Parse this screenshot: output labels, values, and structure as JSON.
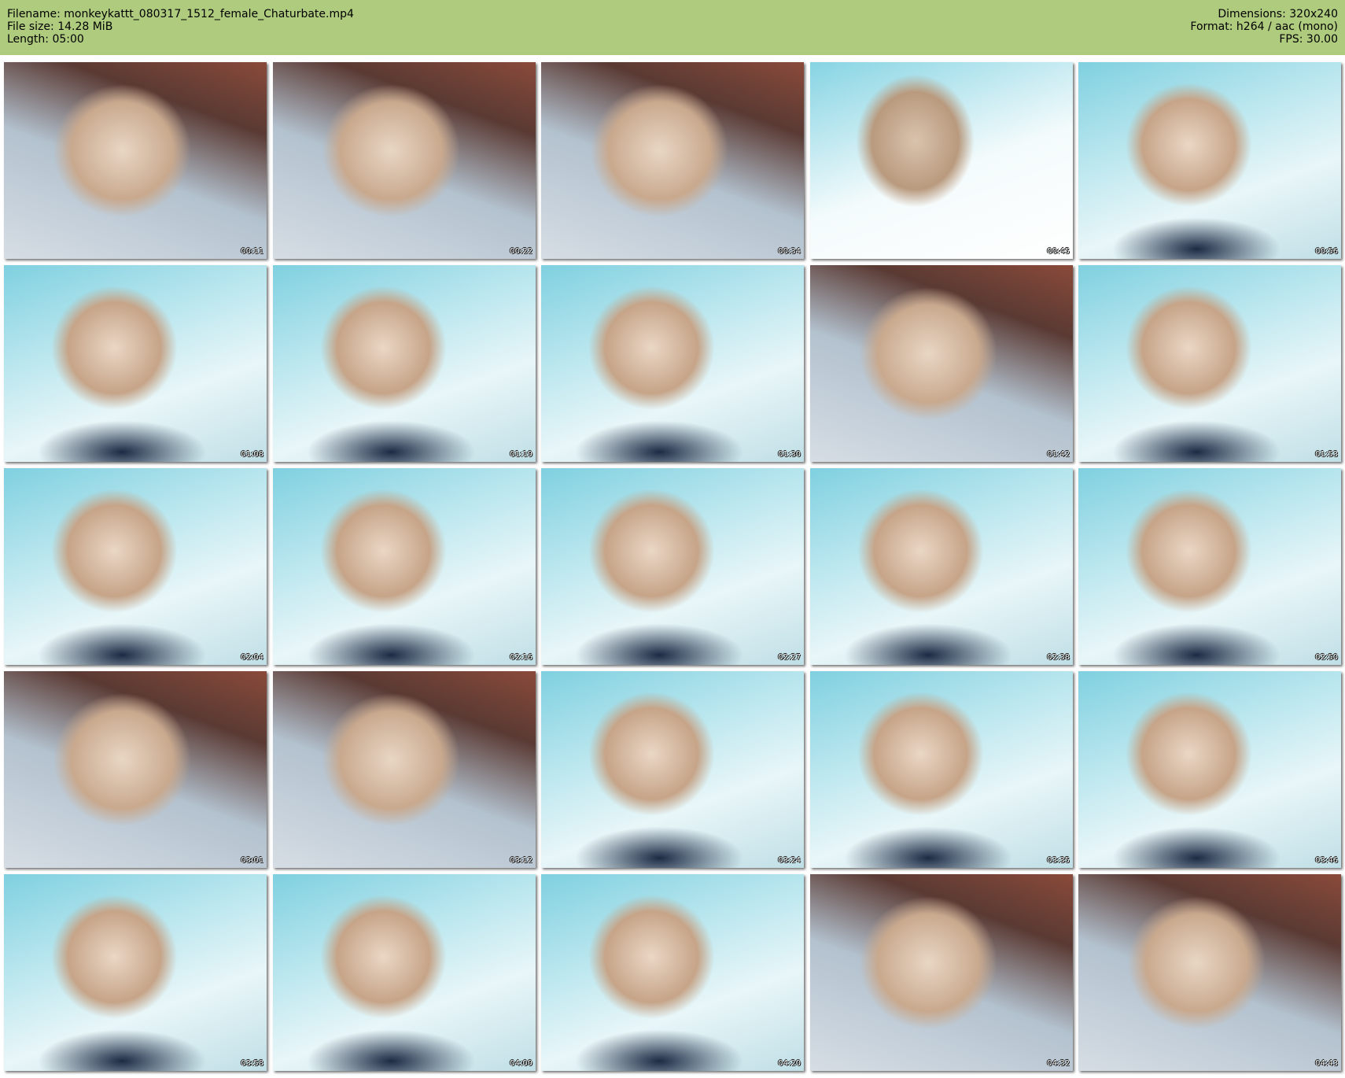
{
  "header": {
    "filename": "Filename: monkeykattt_080317_1512_female_Chaturbate.mp4",
    "filesize": "File size: 14.28 MiB",
    "length": "Length: 05:00",
    "dimensions": "Dimensions: 320x240",
    "format": "Format: h264 / aac (mono)",
    "fps": "FPS: 30.00"
  },
  "colors": {
    "header_bg": "#aecb7e",
    "page_bg": "#ffffff"
  },
  "thumbnails": [
    {
      "time": "00:11",
      "scene": "room"
    },
    {
      "time": "00:22",
      "scene": "room"
    },
    {
      "time": "00:34",
      "scene": "room"
    },
    {
      "time": "00:45",
      "scene": "bright"
    },
    {
      "time": "00:56",
      "scene": "bed"
    },
    {
      "time": "01:08",
      "scene": "bed"
    },
    {
      "time": "01:19",
      "scene": "bed"
    },
    {
      "time": "01:30",
      "scene": "bed"
    },
    {
      "time": "01:42",
      "scene": "room"
    },
    {
      "time": "01:53",
      "scene": "bed"
    },
    {
      "time": "02:04",
      "scene": "bed"
    },
    {
      "time": "02:16",
      "scene": "bed"
    },
    {
      "time": "02:27",
      "scene": "bed"
    },
    {
      "time": "02:38",
      "scene": "bed"
    },
    {
      "time": "02:50",
      "scene": "bed"
    },
    {
      "time": "03:01",
      "scene": "room"
    },
    {
      "time": "03:12",
      "scene": "room"
    },
    {
      "time": "03:24",
      "scene": "bed"
    },
    {
      "time": "03:35",
      "scene": "bed"
    },
    {
      "time": "03:46",
      "scene": "bed"
    },
    {
      "time": "03:58",
      "scene": "bed"
    },
    {
      "time": "04:09",
      "scene": "bed"
    },
    {
      "time": "04:20",
      "scene": "bed"
    },
    {
      "time": "04:32",
      "scene": "room"
    },
    {
      "time": "04:43",
      "scene": "room"
    }
  ]
}
